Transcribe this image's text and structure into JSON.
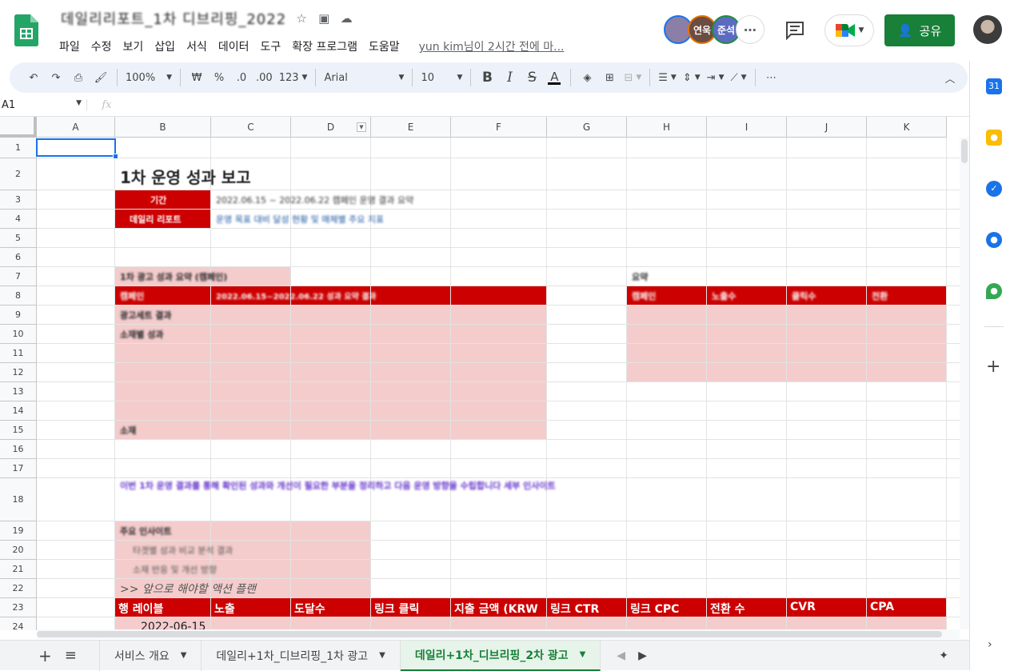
{
  "app": {
    "doc_title": "데일리리포트_1차 디브리핑_2022",
    "menu": [
      "파일",
      "수정",
      "보기",
      "삽입",
      "서식",
      "데이터",
      "도구",
      "확장 프로그램",
      "도움말"
    ],
    "last_edit": "yun kim님이 2시간 전에 마..."
  },
  "collaborators": {
    "a1": "",
    "a2": "연욱",
    "a3": "준석"
  },
  "share": {
    "label": "공유"
  },
  "toolbar": {
    "zoom": "100%",
    "currency": "₩",
    "percent": "%",
    "dec_dec": ".0",
    "dec_inc": ".00",
    "format": "123",
    "font": "Arial",
    "size": "10"
  },
  "formula_bar": {
    "name_box": "A1",
    "fx": "fx"
  },
  "columns": [
    "A",
    "B",
    "C",
    "D",
    "E",
    "F",
    "G",
    "H",
    "I",
    "J",
    "K"
  ],
  "rows": [
    "1",
    "2",
    "3",
    "4",
    "5",
    "6",
    "7",
    "8",
    "9",
    "10",
    "11",
    "12",
    "13",
    "14",
    "15",
    "16",
    "17",
    "18",
    "19",
    "20",
    "21",
    "22",
    "23",
    "24"
  ],
  "cells": {
    "b2_title": "1차 운영 성과 보고",
    "b3_label": "기간",
    "b4_label": "데일리 리포트",
    "c3_blur": "2022.06.15 ~ 2022.06.22 캠페인 운영 결과 요약",
    "c4_blur": "운영 목표 대비 달성 현황 및 매체별 주요 지표",
    "b7_blur": "1차 광고 성과 요약 (캠페인)",
    "b8_blur": "캠페인",
    "c8_blur": "2022.06.15~2022.06.22 성과 요약 결과",
    "b9_blur": "광고세트 결과",
    "b10_blur": "소재별 성과",
    "b15_blur": "소재",
    "h7_blur": "요약",
    "h8_blur": "캠페인",
    "i8_blur": "노출수",
    "j8_blur": "클릭수",
    "k8_blur": "전환",
    "b18_blur": "이번 1차 운영 결과를 통해 확인된 성과와 개선이 필요한 부분을 정리하고 다음 운영 방향을 수립합니다 세부 인사이트",
    "b19_blur": "주요 인사이트",
    "b20_blur": "타겟별 성과 비교 분석 결과",
    "b21_blur": "소재 반응 및 개선 방향",
    "b22_text": ">> 앞으로 해야할 액션 플랜",
    "row23": [
      "행 레이블",
      "노출",
      "도달수",
      "링크 클릭",
      "지출 금액 (KRW",
      "링크 CTR",
      "링크 CPC",
      "전환 수",
      "CVR",
      "CPA"
    ],
    "b24_date": "2022-06-15"
  },
  "sheet_tabs": [
    "서비스 개요",
    "데일리+1차_디브리핑_1차 광고",
    "데일리+1차_디브리핑_2차 광고"
  ],
  "colors": {
    "brand_green": "#188038",
    "header_red": "#cc0000",
    "light_pink": "#f4cccc",
    "selection_blue": "#1a73e8"
  }
}
